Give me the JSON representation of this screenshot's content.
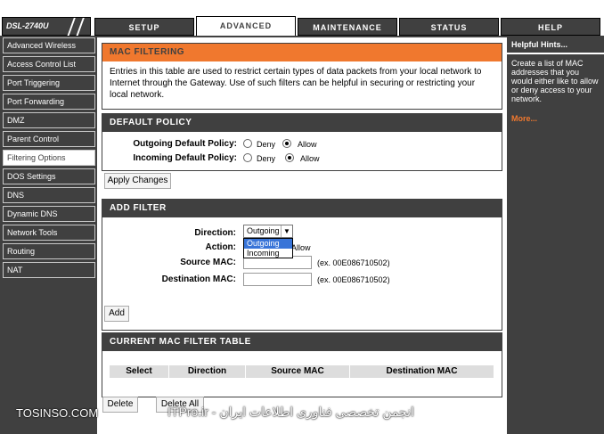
{
  "header": {
    "logo_text": "DSL-2740U",
    "tabs": [
      "SETUP",
      "ADVANCED",
      "MAINTENANCE",
      "STATUS",
      "HELP"
    ],
    "active_tab": "ADVANCED"
  },
  "sidebar": {
    "items": [
      "Advanced Wireless",
      "Access Control List",
      "Port Triggering",
      "Port Forwarding",
      "DMZ",
      "Parent Control",
      "Filtering Options",
      "DOS Settings",
      "DNS",
      "Dynamic DNS",
      "Network Tools",
      "Routing",
      "NAT"
    ],
    "selected": "Filtering Options"
  },
  "mac_filtering": {
    "title": "MAC FILTERING",
    "description": "Entries in this table are used to restrict certain types of data packets from your local network to Internet through the Gateway. Use of such filters can be helpful in securing or restricting your local network."
  },
  "default_policy": {
    "title": "DEFAULT POLICY",
    "outgoing_label": "Outgoing Default Policy:",
    "incoming_label": "Incoming Default Policy:",
    "deny": "Deny",
    "allow": "Allow",
    "outgoing_value": "Allow",
    "incoming_value": "Allow",
    "apply_button": "Apply Changes"
  },
  "add_filter": {
    "title": "ADD FILTER",
    "direction_label": "Direction:",
    "direction_value": "Outgoing",
    "direction_options": [
      "Outgoing",
      "Incoming"
    ],
    "action_label": "Action:",
    "action_allow": "Allow",
    "source_mac_label": "Source MAC:",
    "destination_mac_label": "Destination MAC:",
    "source_hint": "(ex. 00E086710502)",
    "destination_hint": "(ex. 00E086710502)",
    "add_button": "Add"
  },
  "current_table": {
    "title": "CURRENT MAC FILTER TABLE",
    "columns": [
      "Select",
      "Direction",
      "Source MAC",
      "Destination MAC"
    ],
    "delete_button": "Delete",
    "delete_all_button": "Delete All"
  },
  "hints": {
    "title": "Helpful Hints...",
    "text": "Create a list of MAC addresses that you would either like to allow or deny access to your network.",
    "more": "More..."
  },
  "watermark": {
    "left": "TOSINSO.COM",
    "right": "ITPro.ir - انجمن تخصصی فناوری اطلاعات ایران"
  },
  "colors": {
    "dark": "#404040",
    "accent": "#f0782e",
    "more_link": "#f0782e"
  }
}
